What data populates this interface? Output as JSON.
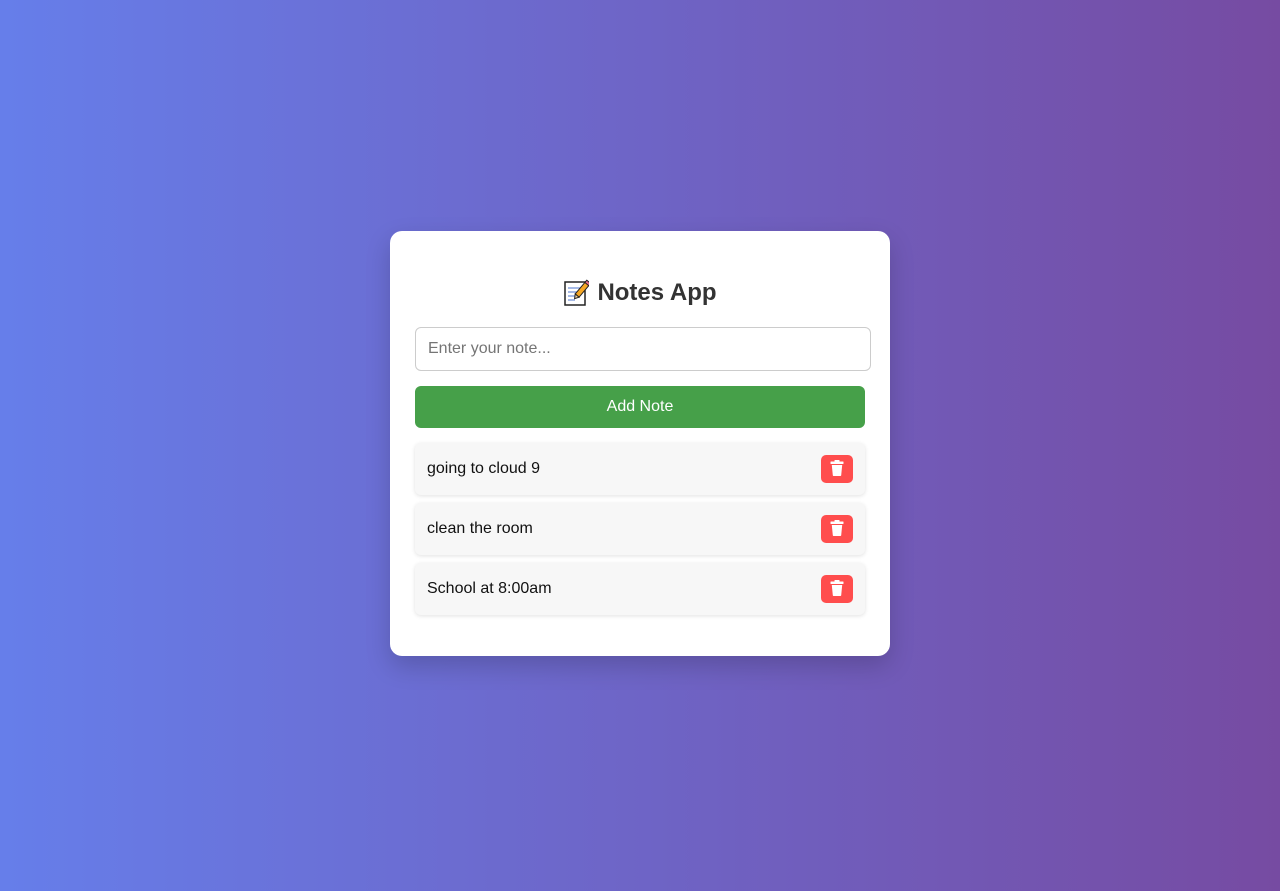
{
  "app": {
    "title": "Notes App",
    "title_icon": "memo-icon"
  },
  "input": {
    "placeholder": "Enter your note...",
    "value": ""
  },
  "add_button": {
    "label": "Add Note",
    "color": "#46a049"
  },
  "notes": [
    {
      "text": "going to cloud 9",
      "delete_icon": "trash-icon"
    },
    {
      "text": "clean the room",
      "delete_icon": "trash-icon"
    },
    {
      "text": "School at 8:00am",
      "delete_icon": "trash-icon"
    }
  ],
  "colors": {
    "background_start": "#667eea",
    "background_end": "#764ba2",
    "delete": "#ff4d4d"
  }
}
